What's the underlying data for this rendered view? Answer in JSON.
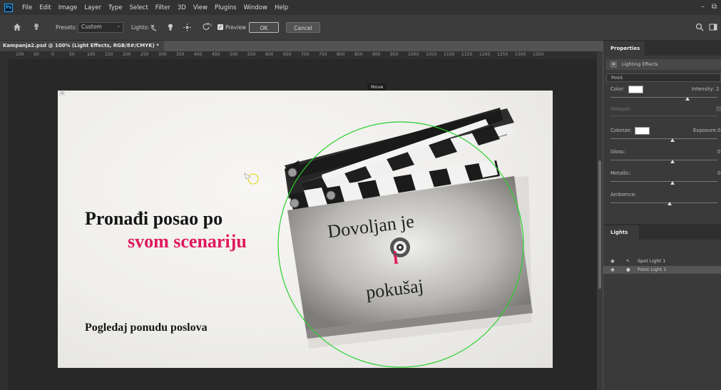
{
  "app": {
    "logo": "Ps"
  },
  "menu": [
    "File",
    "Edit",
    "Image",
    "Layer",
    "Type",
    "Select",
    "Filter",
    "3D",
    "View",
    "Plugins",
    "Window",
    "Help"
  ],
  "optionsbar": {
    "presets_label": "Presets:",
    "presets_value": "Custom",
    "lights_label": "Lights:",
    "preview_label": "Preview",
    "ok_label": "OK",
    "cancel_label": "Cancel"
  },
  "document": {
    "tab_title": "Kampanja2.psd @ 100% (Light Effects, RGB/8#/CMYK) *",
    "close_glyph": "×"
  },
  "ruler": {
    "h_ticks": [
      "100",
      "50",
      "0",
      "50",
      "100",
      "150",
      "200",
      "250",
      "300",
      "350",
      "400",
      "450",
      "500",
      "550",
      "600",
      "650",
      "700",
      "750",
      "800",
      "850",
      "900",
      "950",
      "1000",
      "1050",
      "1100",
      "1150",
      "1200",
      "1250",
      "1300",
      "1350"
    ]
  },
  "canvas": {
    "tooltip": "Move",
    "headline_line1": "Pronađi posao po",
    "headline_line2": "svom scenariju",
    "cta": "Pogledaj ponudu poslova",
    "slate_line1": "Dovoljan je",
    "slate_line2": "i",
    "slate_line3": "pokušaj",
    "accent_color": "#e0195c"
  },
  "properties": {
    "tab": "Properties",
    "header": "Lighting Effects",
    "light_type": "Point",
    "color_label": "Color:",
    "intensity_label": "Intensity:",
    "intensity_value": "2",
    "hotspot_label": "Hotspot:",
    "colorize_label": "Colorize:",
    "exposure_label": "Exposure:",
    "exposure_value": "0",
    "gloss_label": "Gloss:",
    "gloss_value": "0",
    "metallic_label": "Metallic:",
    "metallic_value": "0",
    "ambience_label": "Ambience:"
  },
  "lights": {
    "tab": "Lights",
    "items": [
      {
        "name": "Spot Light 1",
        "icon": "spot-light-icon"
      },
      {
        "name": "Point Light 1",
        "icon": "point-light-icon",
        "selected": true
      }
    ]
  }
}
